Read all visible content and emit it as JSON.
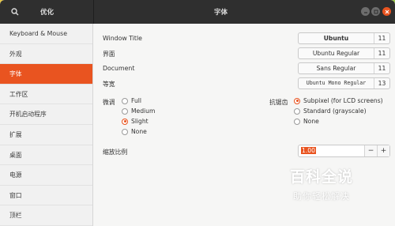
{
  "header": {
    "left_title": "优化",
    "title": "字体",
    "search_icon": "search-icon",
    "accent": "#e95420"
  },
  "sidebar": {
    "items": [
      {
        "label": "Keyboard & Mouse"
      },
      {
        "label": "外观"
      },
      {
        "label": "字体"
      },
      {
        "label": "工作区"
      },
      {
        "label": "开机启动程序"
      },
      {
        "label": "扩展"
      },
      {
        "label": "桌面"
      },
      {
        "label": "电源"
      },
      {
        "label": "窗口"
      },
      {
        "label": "顶栏"
      }
    ],
    "active_index": 2
  },
  "fonts": {
    "window_title": {
      "label": "Window Title",
      "font": "Ubuntu",
      "size": "11"
    },
    "interface": {
      "label": "界面",
      "font": "Ubuntu Regular",
      "size": "11"
    },
    "document": {
      "label": "Document",
      "font": "Sans Regular",
      "size": "11"
    },
    "monospace": {
      "label": "等宽",
      "font": "Ubuntu Mono Regular",
      "size": "13"
    }
  },
  "hinting": {
    "label": "微调",
    "options": [
      "Full",
      "Medium",
      "Slight",
      "None"
    ],
    "selected": "Slight"
  },
  "antialiasing": {
    "label": "抗锯齿",
    "options": [
      "Subpixel (for LCD screens)",
      "Standard (grayscale)",
      "None"
    ],
    "selected": "Subpixel (for LCD screens)"
  },
  "scaling": {
    "label": "缩放比例",
    "value": "1.00",
    "minus": "−",
    "plus": "+"
  },
  "watermark": {
    "main": "百科全说",
    "sub": "助你轻松解决"
  }
}
